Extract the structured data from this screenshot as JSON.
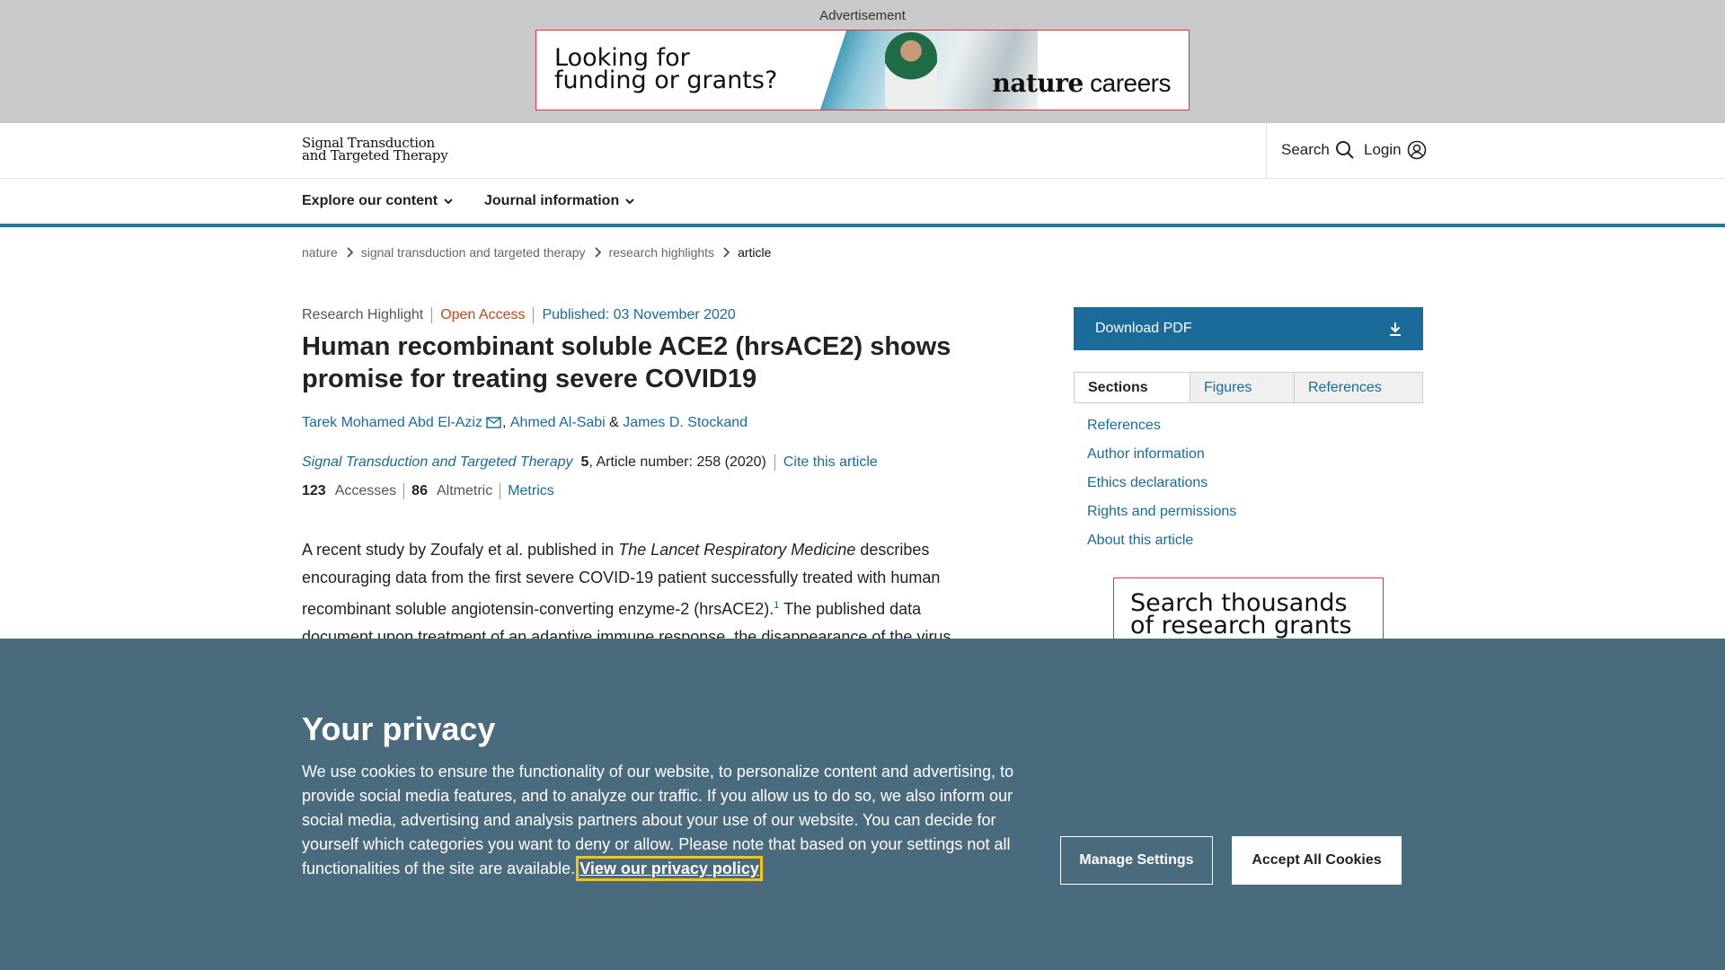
{
  "ad": {
    "label": "Advertisement",
    "headline_line1": "Looking for",
    "headline_line2": "funding or grants?",
    "brand_bold": "nature",
    "brand_rest": " careers"
  },
  "header": {
    "logo_line1": "Signal Transduction",
    "logo_line2": "and Targeted Therapy",
    "search_label": "Search",
    "login_label": "Login"
  },
  "nav": {
    "items": [
      {
        "label": "Explore our content"
      },
      {
        "label": "Journal information"
      }
    ]
  },
  "breadcrumb": [
    "nature",
    "signal transduction and targeted therapy",
    "research highlights",
    "article"
  ],
  "article": {
    "type": "Research Highlight",
    "access": "Open Access",
    "published": "Published: 03 November 2020",
    "title": "Human recombinant soluble ACE2 (hrsACE2) shows promise for treating severe COVID19",
    "authors": [
      "Tarek Mohamed Abd El-Aziz",
      "Ahmed Al-Sabi",
      "James D. Stockand"
    ],
    "author_sep": ", ",
    "author_and": " & ",
    "journal": "Signal Transduction and Targeted Therapy",
    "volume": "5",
    "article_number": ", Article number: 258 (2020)",
    "cite_label": "Cite this article",
    "accesses_value": "123",
    "accesses_label": "Accesses",
    "altmetric_value": "86",
    "altmetric_label": "Altmetric",
    "metrics_label": "Metrics",
    "abstract_part1": "A recent study by Zoufaly et al. published in ",
    "abstract_italic": "The Lancet Respiratory Medicine",
    "abstract_part2": " describes encouraging data from the first severe COVID-19 patient successfully treated with human recombinant soluble angiotensin-converting enzyme-2 (hrsACE2).",
    "abstract_ref": "1",
    "abstract_part3": " The published data document upon treatment of an adaptive immune response, the disappearance of the virus"
  },
  "sidebar": {
    "download_pdf": "Download PDF",
    "tabs": [
      "Sections",
      "Figures",
      "References"
    ],
    "links": [
      "References",
      "Author information",
      "Ethics declarations",
      "Rights and permissions",
      "About this article"
    ],
    "ad_line1": "Search thousands",
    "ad_line2": "of research grants"
  },
  "privacy": {
    "title": "Your privacy",
    "text": "We use cookies to ensure the functionality of our website, to personalize content and advertising, to provide social media features, and to analyze our traffic. If you allow us to do so, we also inform our social media, advertising and analysis partners about your use of our website. You can decide for yourself which categories you want to deny or allow. Please note that based on your settings not all functionalities of the site are available. ",
    "policy_link": "View our privacy policy",
    "manage_label": "Manage Settings",
    "accept_label": "Accept All Cookies"
  }
}
